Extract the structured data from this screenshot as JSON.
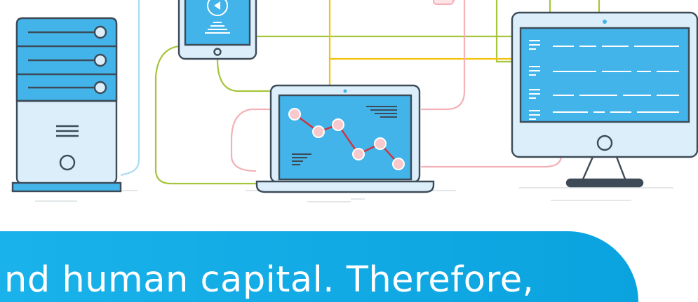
{
  "banner": {
    "text": "nd human capital. Therefore,"
  },
  "colors": {
    "outline": "#3d4a57",
    "screen_blue": "#42b4ea",
    "device_fill": "#dbeefa",
    "wire_yellow": "#f4c20d",
    "wire_green": "#a6c53c",
    "wire_pink": "#f4b1b7",
    "wire_lightblue": "#a9dcf3",
    "graph_line": "#d0343d",
    "graph_node": "#f7c9cc",
    "banner": "#0aa3df"
  },
  "icons": [
    "server-tower-icon",
    "tablet-play-icon",
    "laptop-chart-icon",
    "desktop-monitor-icon"
  ]
}
